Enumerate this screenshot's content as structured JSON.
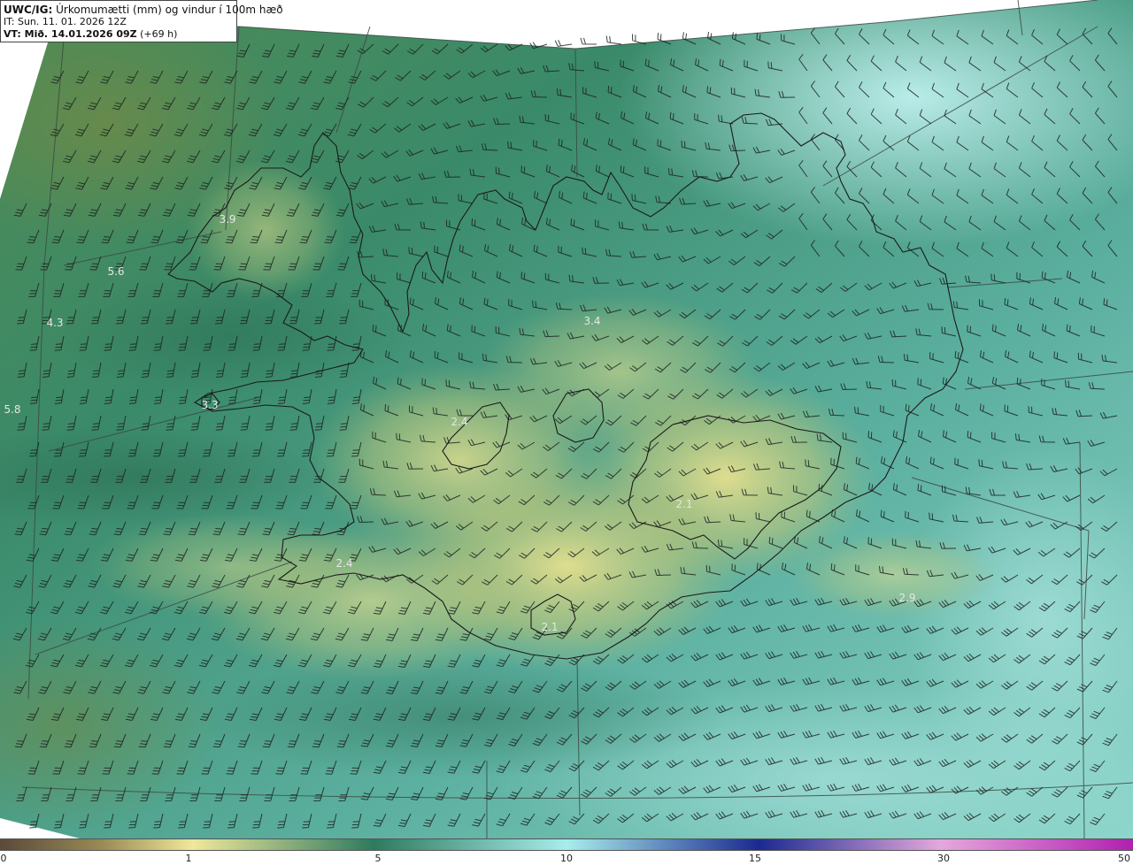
{
  "header": {
    "product_label": "UWC/IG:",
    "title_text": " Úrkomumætti (mm) og vindur í 100m hæð",
    "init_time": "IT: Sun. 11. 01. 2026 12Z",
    "valid_prefix": "VT: Mið. 14.01.2026 09Z",
    "valid_suffix": " (+69 h)"
  },
  "map": {
    "value_labels": [
      {
        "text": "3.9",
        "name": "value-3-9-westfjords"
      },
      {
        "text": "5.6",
        "name": "value-5-6-west-sea"
      },
      {
        "text": "4.3",
        "name": "value-4-3-west-sea"
      },
      {
        "text": "5.8",
        "name": "value-5-8-far-west"
      },
      {
        "text": "3.3",
        "name": "value-3-3-snaefellsnes"
      },
      {
        "text": "3.4",
        "name": "value-3-4-north"
      },
      {
        "text": "2.4",
        "name": "value-2-4-langjokull"
      },
      {
        "text": "2.4",
        "name": "value-2-4-southwest"
      },
      {
        "text": "2.9",
        "name": "value-2-9-southeast-sea"
      },
      {
        "text": "2.1",
        "name": "value-2-1-vatnajokull"
      },
      {
        "text": "2.1",
        "name": "value-2-1-myrdalsjokull"
      }
    ]
  },
  "legend": {
    "ticks": [
      "0",
      "1",
      "5",
      "10",
      "15",
      "30",
      "50"
    ],
    "colors": [
      "#5a4a38",
      "#9a8a55",
      "#efe89a",
      "#2e7a5e",
      "#a8ecec",
      "#1a2a90",
      "#e4a8dc",
      "#b020b0"
    ]
  }
}
